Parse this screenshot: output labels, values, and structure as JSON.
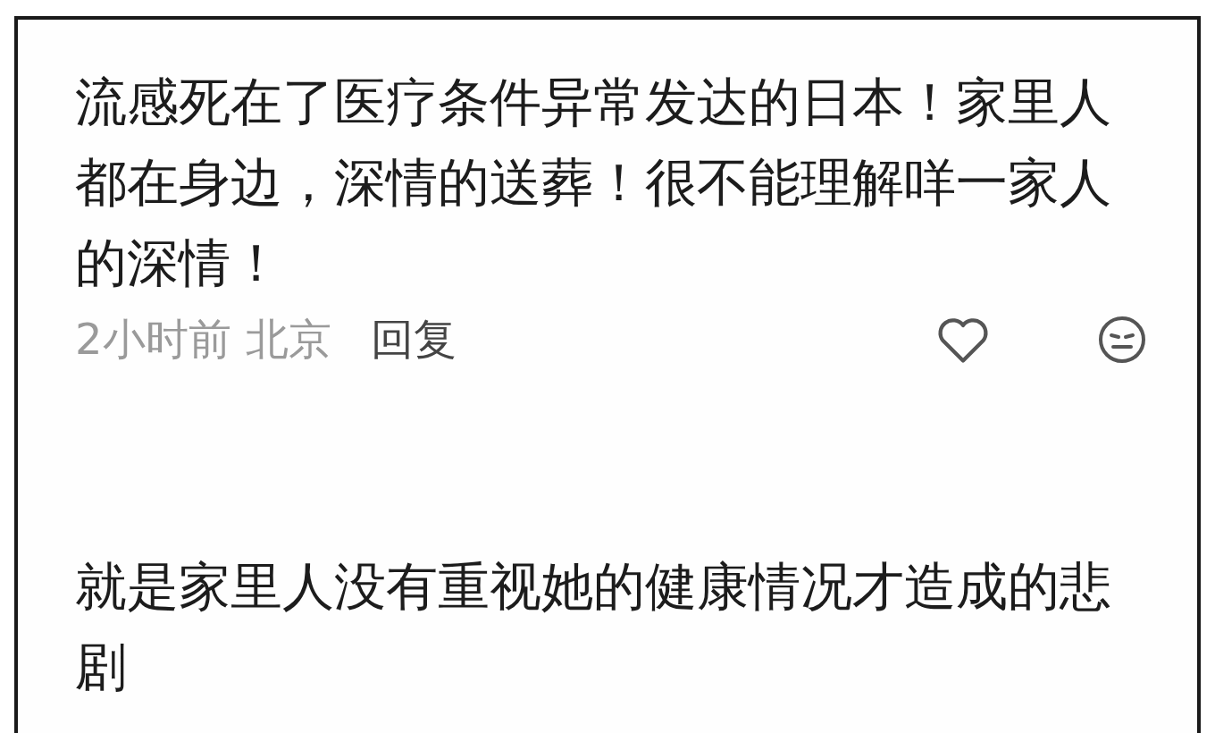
{
  "comments": [
    {
      "text": "流感死在了医疗条件异常发达的日本！家里人都在身边，深情的送葬！很不能理解咩一家人的深情！",
      "time": "2小时前",
      "location": "北京",
      "reply_label": "回复"
    },
    {
      "text": "就是家里人没有重视她的健康情况才造成的悲剧"
    }
  ]
}
